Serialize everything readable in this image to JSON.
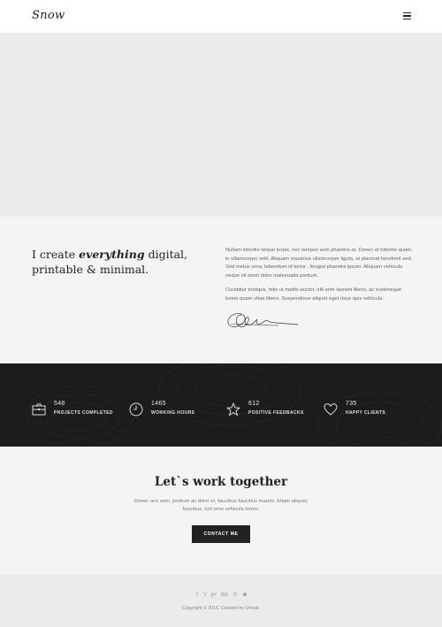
{
  "header": {
    "logo": "Snow",
    "menu_icon": "hamburger-icon"
  },
  "hero": {
    "background_color": "#ebebeb"
  },
  "intro": {
    "headline_pre": "I create ",
    "headline_em": "everything",
    "headline_post": " digital, printable & minimal.",
    "paragraph_1": "Nullam lobortis neque turpis, nec tempus sem pharetra at. Donec et lobortis quam, in ullamcorper velit. Aliquam maximus ullamcorper ligula, at placerat hendrerit sed. Sed metus urna, bibendum id tortor , feugiat pharetra ipsum. Aliquam vehicula neque sit amet dolor malesuada pretium.",
    "paragraph_2": "Curabitur tristique, felis ut mattis auctor, elit ante laoreet libero, ac scelerisque lorem quam vitae libero. Suspendisse aliquet eget risus quis vehicula.",
    "signature_icon": "signature-icon"
  },
  "stats": {
    "items": [
      {
        "value": "548",
        "label": "PROJECTS COMPLETED",
        "icon": "briefcase-icon"
      },
      {
        "value": "1465",
        "label": "WORKING HOURS",
        "icon": "clock-icon"
      },
      {
        "value": "612",
        "label": "POSITIVE FEEDBACKS",
        "icon": "star-icon"
      },
      {
        "value": "735",
        "label": "HAPPY CLIENTS",
        "icon": "heart-icon"
      }
    ],
    "background_color": "#1c1c1c"
  },
  "cta": {
    "title": "Let`s work together",
    "text": "Donec orci sem, pretium ac dolor et, faucibus faucibus mauris. Etiam aliquet, faucibus, nisl eros vehicula lorem.",
    "button_label": "CONTACT ME",
    "button_color": "#222222"
  },
  "footer": {
    "social": [
      {
        "glyph": "f",
        "icon": "facebook-icon"
      },
      {
        "glyph": "𝕐",
        "icon": "twitter-icon"
      },
      {
        "glyph": "g+",
        "icon": "google-plus-icon"
      },
      {
        "glyph": "Bē",
        "icon": "behance-icon"
      },
      {
        "glyph": "℗",
        "icon": "pinterest-icon"
      },
      {
        "glyph": "◙",
        "icon": "instagram-icon"
      }
    ],
    "copyright": "Copyright © 2016. Created by Unvab."
  }
}
